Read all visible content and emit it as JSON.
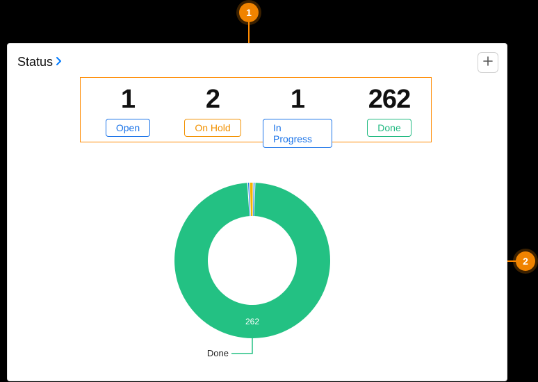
{
  "header": {
    "title": "Status"
  },
  "stats": {
    "open": {
      "count": "1",
      "label": "Open"
    },
    "hold": {
      "count": "2",
      "label": "On Hold"
    },
    "progress": {
      "count": "1",
      "label": "In Progress"
    },
    "done": {
      "count": "262",
      "label": "Done"
    }
  },
  "chart_data": {
    "type": "pie",
    "title": "",
    "series": [
      {
        "name": "Open",
        "value": 1,
        "color": "#1a73e8"
      },
      {
        "name": "On Hold",
        "value": 2,
        "color": "#f5b400"
      },
      {
        "name": "In Progress",
        "value": 1,
        "color": "#1a73e8"
      },
      {
        "name": "Done",
        "value": 262,
        "color": "#23c183"
      }
    ],
    "callouts": {
      "done": {
        "label": "Done",
        "value": "262"
      }
    }
  },
  "annotations": {
    "badge1": "1",
    "badge2": "2"
  }
}
